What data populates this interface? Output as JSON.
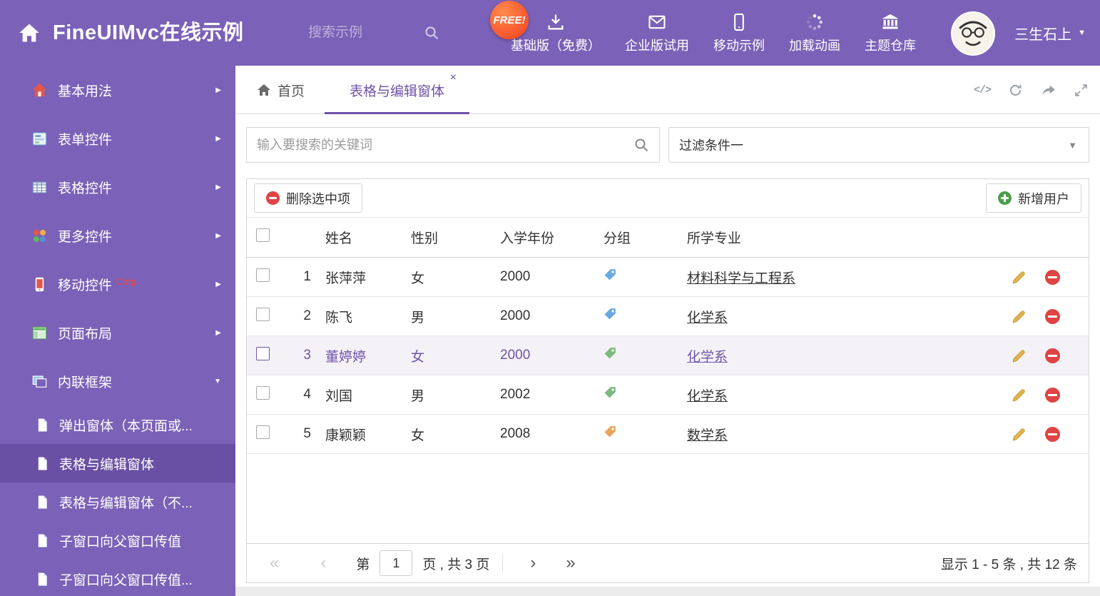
{
  "header": {
    "title": "FineUIMvc在线示例",
    "search_placeholder": "搜索示例",
    "free_badge": "FREE!",
    "nav": [
      {
        "label": "基础版（免费）",
        "icon": "download-icon"
      },
      {
        "label": "企业版试用",
        "icon": "envelope-icon"
      },
      {
        "label": "移动示例",
        "icon": "mobile-icon"
      },
      {
        "label": "加载动画",
        "icon": "spinner-icon"
      },
      {
        "label": "主题仓库",
        "icon": "bank-icon"
      }
    ],
    "username": "三生石上"
  },
  "sidebar": {
    "items": [
      {
        "label": "基本用法",
        "icon": "home-icon"
      },
      {
        "label": "表单控件",
        "icon": "form-icon"
      },
      {
        "label": "表格控件",
        "icon": "table-icon"
      },
      {
        "label": "更多控件",
        "icon": "blocks-icon"
      },
      {
        "label": "移动控件",
        "icon": "phone-icon",
        "badge": "Corp."
      },
      {
        "label": "页面布局",
        "icon": "layout-icon"
      },
      {
        "label": "内联框架",
        "icon": "frame-icon",
        "expanded": true
      }
    ],
    "subitems": [
      {
        "label": "弹出窗体（本页面或..."
      },
      {
        "label": "表格与编辑窗体",
        "active": true
      },
      {
        "label": "表格与编辑窗体（不..."
      },
      {
        "label": "子窗口向父窗口传值"
      },
      {
        "label": "子窗口向父窗口传值..."
      }
    ]
  },
  "tabs": {
    "home": "首页",
    "active": "表格与编辑窗体"
  },
  "filters": {
    "search_placeholder": "输入要搜索的关键词",
    "dropdown_value": "过滤条件一"
  },
  "grid": {
    "delete_button": "删除选中项",
    "add_button": "新增用户",
    "columns": [
      "姓名",
      "性别",
      "入学年份",
      "分组",
      "所学专业"
    ],
    "rows": [
      {
        "num": "1",
        "name": "张萍萍",
        "gender": "女",
        "year": "2000",
        "tag_color": "#6aa9e0",
        "major": "材料科学与工程系",
        "selected": false
      },
      {
        "num": "2",
        "name": "陈飞",
        "gender": "男",
        "year": "2000",
        "tag_color": "#6aa9e0",
        "major": "化学系",
        "selected": false
      },
      {
        "num": "3",
        "name": "董婷婷",
        "gender": "女",
        "year": "2000",
        "tag_color": "#7cb97e",
        "major": "化学系",
        "selected": true
      },
      {
        "num": "4",
        "name": "刘国",
        "gender": "男",
        "year": "2002",
        "tag_color": "#7cb97e",
        "major": "化学系",
        "selected": false
      },
      {
        "num": "5",
        "name": "康颖颖",
        "gender": "女",
        "year": "2008",
        "tag_color": "#e8a45c",
        "major": "数学系",
        "selected": false
      }
    ]
  },
  "pagination": {
    "prefix": "第",
    "page": "1",
    "suffix": "页 , 共 3 页",
    "summary": "显示 1 - 5 条 , 共 12 条"
  },
  "icons": {
    "close": "×",
    "caret_down": "▼",
    "menu_arrow": "▶",
    "menu_arrow_expanded": "▼",
    "code": "</>",
    "pager_first": "«",
    "pager_prev": "‹",
    "pager_next": "›",
    "pager_last": "»"
  },
  "colors": {
    "accent_purple": "#7b61b7",
    "accent_purple_dark": "#6a50a4",
    "active_text": "#6f52a8",
    "free_badge": "#f43e1e",
    "delete_red": "#e04343",
    "add_green": "#4a9e4a"
  }
}
